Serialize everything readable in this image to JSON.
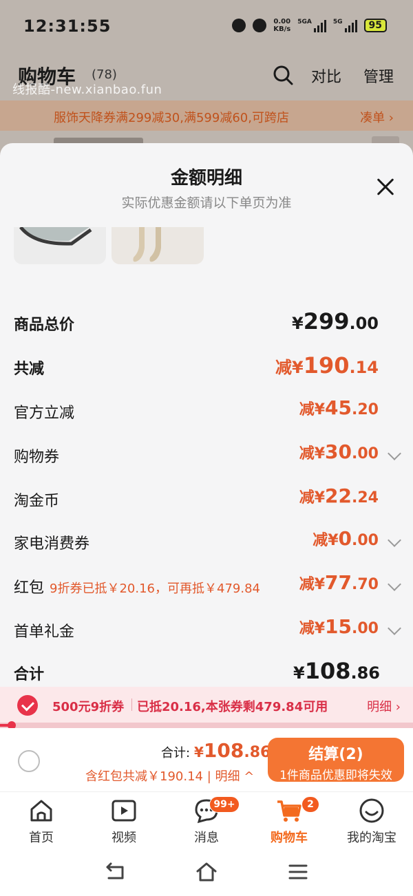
{
  "status_bar": {
    "time": "12:31:55",
    "net_speed_value": "0.00",
    "net_speed_unit": "KB/s",
    "sig1_label": "5GA",
    "sig2_label": "5G",
    "battery": "95"
  },
  "cart_header": {
    "title": "购物车",
    "count": "(78)",
    "compare_label": "对比",
    "manage_label": "管理"
  },
  "watermark": "线报酷-new.xianbao.fun",
  "promo_bar": {
    "text": "服饰天降券满299减30,满599减60,可跨店",
    "more_label": "凑单 ›"
  },
  "sheet": {
    "title": "金额明细",
    "subtitle": "实际优惠金额请以下单页为准"
  },
  "breakdown": {
    "total_price": {
      "label": "商品总价",
      "pre": "¥",
      "int": "299",
      "dec": ".00"
    },
    "total_discount": {
      "label": "共减",
      "pre": "减¥",
      "int": "190",
      "dec": ".14"
    },
    "official": {
      "label": "官方立减",
      "pre": "减¥",
      "int": "45",
      "dec": ".20"
    },
    "coupon": {
      "label": "购物券",
      "pre": "减¥",
      "int": "30",
      "dec": ".00"
    },
    "gold_coin": {
      "label": "淘金币",
      "pre": "减¥",
      "int": "22",
      "dec": ".24"
    },
    "appliance": {
      "label": "家电消费券",
      "pre": "减¥",
      "int": "0",
      "dec": ".00"
    },
    "red_packet": {
      "label": "红包",
      "note": "9折券已抵￥20.16，可再抵￥479.84",
      "pre": "减¥",
      "int": "77",
      "dec": ".70"
    },
    "first_order": {
      "label": "首单礼金",
      "pre": "减¥",
      "int": "15",
      "dec": ".00"
    },
    "sum": {
      "label": "合计",
      "pre": "¥",
      "int": "108",
      "dec": ".86"
    }
  },
  "coupon_strip": {
    "name": "500元9折券",
    "info": "已抵20.16,本张券剩479.84可用",
    "link": "明细 ›",
    "progress_fraction": 0.03
  },
  "checkout": {
    "sum_label": "合计:",
    "sum_pre": "¥",
    "sum_int": "108",
    "sum_dec": ".86",
    "sub": "含红包共减￥190.14 | 明细 ^",
    "pay_label": "结算(2)",
    "pay_sub": "1件商品优惠即将失效"
  },
  "tabs": [
    {
      "label": "首页",
      "icon": "home-icon"
    },
    {
      "label": "视频",
      "icon": "video-icon"
    },
    {
      "label": "消息",
      "icon": "message-icon",
      "badge": "99+"
    },
    {
      "label": "购物车",
      "icon": "cart-icon",
      "badge": "2",
      "active": true
    },
    {
      "label": "我的淘宝",
      "icon": "profile-icon"
    }
  ],
  "colors": {
    "accent": "#e2592c",
    "pay_button": "#f47533",
    "coupon_red": "#d92f47",
    "tab_active": "#f36a1e"
  }
}
